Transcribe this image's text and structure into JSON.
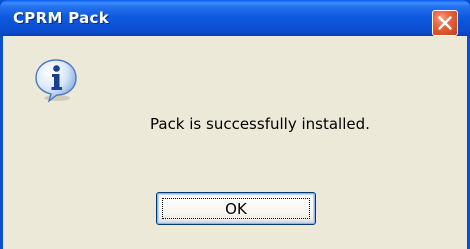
{
  "window": {
    "title": "CPRM Pack",
    "close_icon": "close-icon"
  },
  "dialog": {
    "icon": "info-icon",
    "message": "Pack is successfully installed.",
    "ok_label": "OK"
  },
  "colors": {
    "titlebar": "#0a51d6",
    "client_background": "#ece9d8",
    "close_button": "#d94f26",
    "button_border": "#003c74"
  }
}
